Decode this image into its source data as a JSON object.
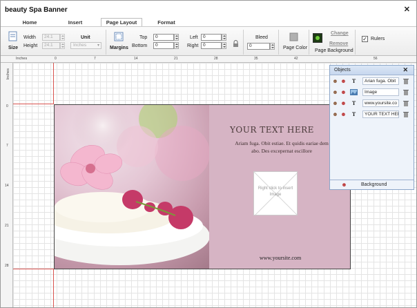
{
  "window": {
    "title": "beauty Spa Banner"
  },
  "tabs": [
    {
      "label": "Home",
      "active": false
    },
    {
      "label": "Insert",
      "active": false
    },
    {
      "label": "Page Layout",
      "active": true
    },
    {
      "label": "Format",
      "active": false
    }
  ],
  "ribbon": {
    "size": {
      "label": "Size",
      "width_label": "Width",
      "height_label": "Height",
      "width_value": "24.1",
      "height_value": "24.1"
    },
    "unit": {
      "label": "Unit",
      "value": "Inches"
    },
    "margins": {
      "label": "Margins",
      "top_label": "Top",
      "bottom_label": "Bottom",
      "left_label": "Left",
      "right_label": "Right",
      "top": "0",
      "bottom": "0",
      "left": "0",
      "right": "0"
    },
    "bleed": {
      "label": "Bleed",
      "value": "0"
    },
    "page_color": {
      "label": "Page Color"
    },
    "page_background": {
      "label": "Page Background",
      "change": "Change",
      "remove": "Remove"
    },
    "rulers": {
      "label": "Rulers",
      "checked": true
    }
  },
  "rulers": {
    "unit_label": "Inches",
    "top_ticks": [
      "0",
      "7",
      "14",
      "21",
      "28",
      "35",
      "42",
      "56"
    ],
    "left_ticks": [
      "0",
      "7",
      "14",
      "21",
      "28"
    ]
  },
  "banner": {
    "headline": "YOUR TEXT HERE",
    "body": "Ariam fuga. Obit estiae. Et quidis eariae dem abo. Des excepernat escillore",
    "image_placeholder": "Right click to insert Image",
    "url": "www.yoursite.com",
    "panel_color": "#d6b4c4"
  },
  "objects_panel": {
    "title": "Objects",
    "items": [
      {
        "type_icon": "text-icon",
        "label": "Arian fuga. Obit"
      },
      {
        "type_icon": "image-icon",
        "label": "Image"
      },
      {
        "type_icon": "text-icon",
        "label": "www.yoursite.co"
      },
      {
        "type_icon": "text-icon",
        "label": "YOUR TEXT HER"
      }
    ],
    "background_label": "Background"
  }
}
